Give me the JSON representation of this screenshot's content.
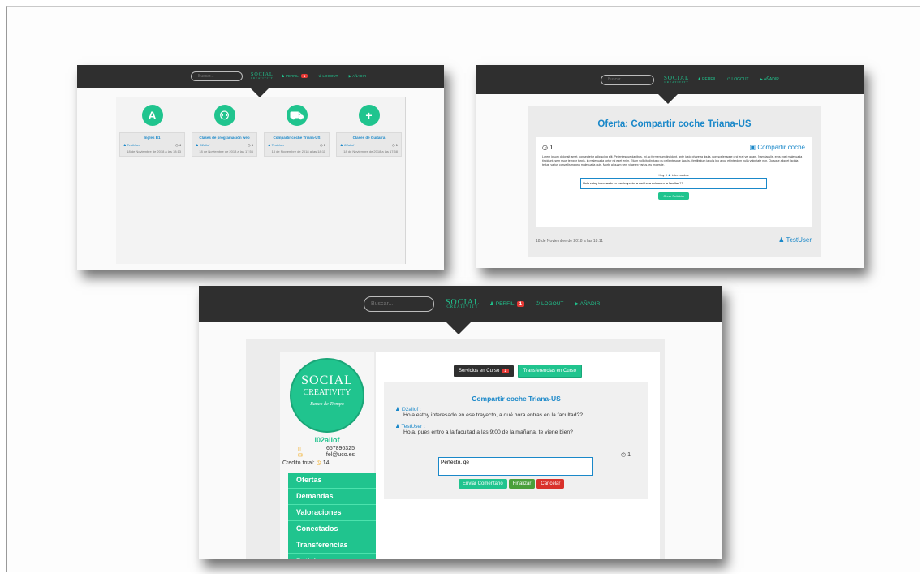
{
  "accent": "#20c48e",
  "topbar": {
    "search_placeholder": "Buscar...",
    "logo_line1": "SOCIAL",
    "logo_line2": "CREATIVITY",
    "perfil": "PERFIL",
    "perfil_badge": "1",
    "logout": "LOGOUT",
    "anadir": "AÑADIR"
  },
  "shot1": {
    "cards": [
      {
        "icon": "language-icon",
        "glyph": "A",
        "title": "Ingles B1",
        "user": "TestUser",
        "count": "4",
        "date": "18 de Noviembre de 2018 a las 18:13"
      },
      {
        "icon": "people-icon",
        "glyph": "⚇",
        "title": "Clases de programación web",
        "user": "i02allof",
        "count": "5",
        "date": "18 de Noviembre de 2018 a las 17:56"
      },
      {
        "icon": "car-icon",
        "glyph": "⛟",
        "title": "Compartir coche Triana-US",
        "user": "TestUser",
        "count": "1",
        "date": "18 de Noviembre de 2018 a las 18:11"
      },
      {
        "icon": "plus-icon",
        "glyph": "+",
        "title": "Clases de Guitarra",
        "user": "i02allof",
        "count": "1",
        "date": "18 de Noviembre de 2018 a las 17:58"
      }
    ]
  },
  "shot2": {
    "title": "Oferta: Compartir coche Triana-US",
    "count": "1",
    "category": "Compartir coche",
    "body": "Lorem ipsum dolor sit amet, consectetur adipiscing elit. Pellentesque dapibus, mi ac fermentum tincidunt, ante justo pharetra ligula, non scelerisque orci erat vel quam. Nam iaculis, eros eget malesuada tincidunt, sem risus tempor turpis, in malesuada tortor mi eget enim. Etiam sollicitudin justo eu pellentesque iaculis. Vestibulum iaculis leo arcu, et interdum nulla vulputate non. Quisque aliquet lacinia tellus, varius convallis magna malesuada quis. Morbi aliquam sem vitae ex varius, eu molestie.",
    "interested_prefix": "Hay 0",
    "interested_suffix": "interesados",
    "input_value": "Hola estoy interesado en ese trayecto, a qué hora entras en la facultad??",
    "submit": "Crear Petición",
    "date": "18 de Noviembre de 2018 a las 18:11",
    "user": "TestUser"
  },
  "shot3": {
    "username": "i02allof",
    "phone": "657896325",
    "email": "fel@uco.es",
    "credit_label": "Credito total:",
    "credit_value": "14",
    "banco": "Banco de Tiempo",
    "menu": [
      "Ofertas",
      "Demandas",
      "Valoraciones",
      "Conectados",
      "Transferencias",
      "Peticiones"
    ],
    "tab_servicios": "Servicios en Curso",
    "tab_servicios_badge": "1",
    "tab_transferencias": "Transferencias en Curso",
    "thread_title": "Compartir coche Triana-US",
    "messages": [
      {
        "author": "i02allof :",
        "text": "Hola estoy interesado en ese trayecto, a qué hora entras en la facultad??"
      },
      {
        "author": "TestUser :",
        "text": "Hola, pues entro a la facultad a las 9:00 de la mañana, te viene bien?"
      }
    ],
    "count": "1",
    "comment_value": "Perfecto, qe",
    "btn_send": "Enviar Comentario",
    "btn_finish": "Finalizar",
    "btn_cancel": "Cancelar"
  }
}
